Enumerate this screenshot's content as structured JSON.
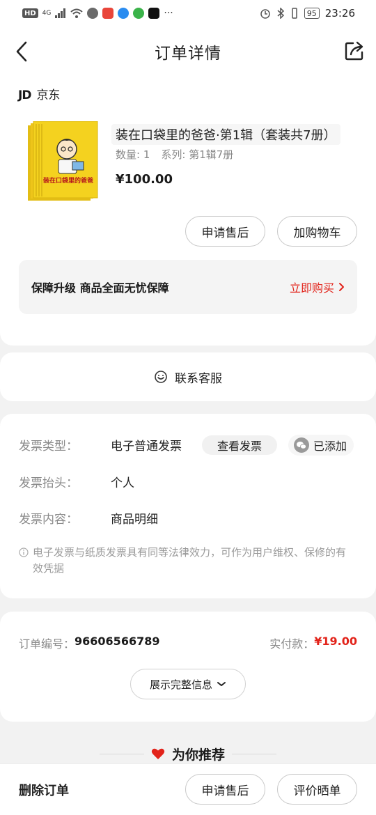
{
  "status_bar": {
    "network": "HD",
    "signal": "4G",
    "battery": "95",
    "time": "23:26",
    "more": "···"
  },
  "header": {
    "title": "订单详情"
  },
  "shop": {
    "logo": "JD",
    "name": "京东"
  },
  "product": {
    "title": "装在口袋里的爸爸·第1辑（套装共7册）",
    "quantity": "数量: 1",
    "series": "系列: 第1辑7册",
    "price": "¥100.00",
    "cover_text": "装在口袋里的爸爸"
  },
  "actions": {
    "after_sale": "申请售后",
    "add_to_cart": "加购物车"
  },
  "guarantee": {
    "title": "保障升级  商品全面无忧保障",
    "link": "立即购买"
  },
  "contact": {
    "label": "联系客服"
  },
  "invoice": {
    "type_label": "发票类型：",
    "type_value": "电子普通发票",
    "view_button": "查看发票",
    "added": "已添加",
    "header_label": "发票抬头：",
    "header_value": "个人",
    "content_label": "发票内容：",
    "content_value": "商品明细",
    "note": "电子发票与纸质发票具有同等法律效力，可作为用户维权、保修的有效凭据"
  },
  "order": {
    "number_label": "订单编号：",
    "number_value": "96606566789",
    "paid_label": "实付款：",
    "paid_value": "¥19.00",
    "expand_button": "展示完整信息"
  },
  "recommend": {
    "title": "为你推荐"
  },
  "bottom_bar": {
    "delete": "删除订单",
    "after_sale": "申请售后",
    "review": "评价晒单"
  },
  "colors": {
    "accent_red": "#e2231a",
    "cover_yellow": "#f4d21f"
  }
}
